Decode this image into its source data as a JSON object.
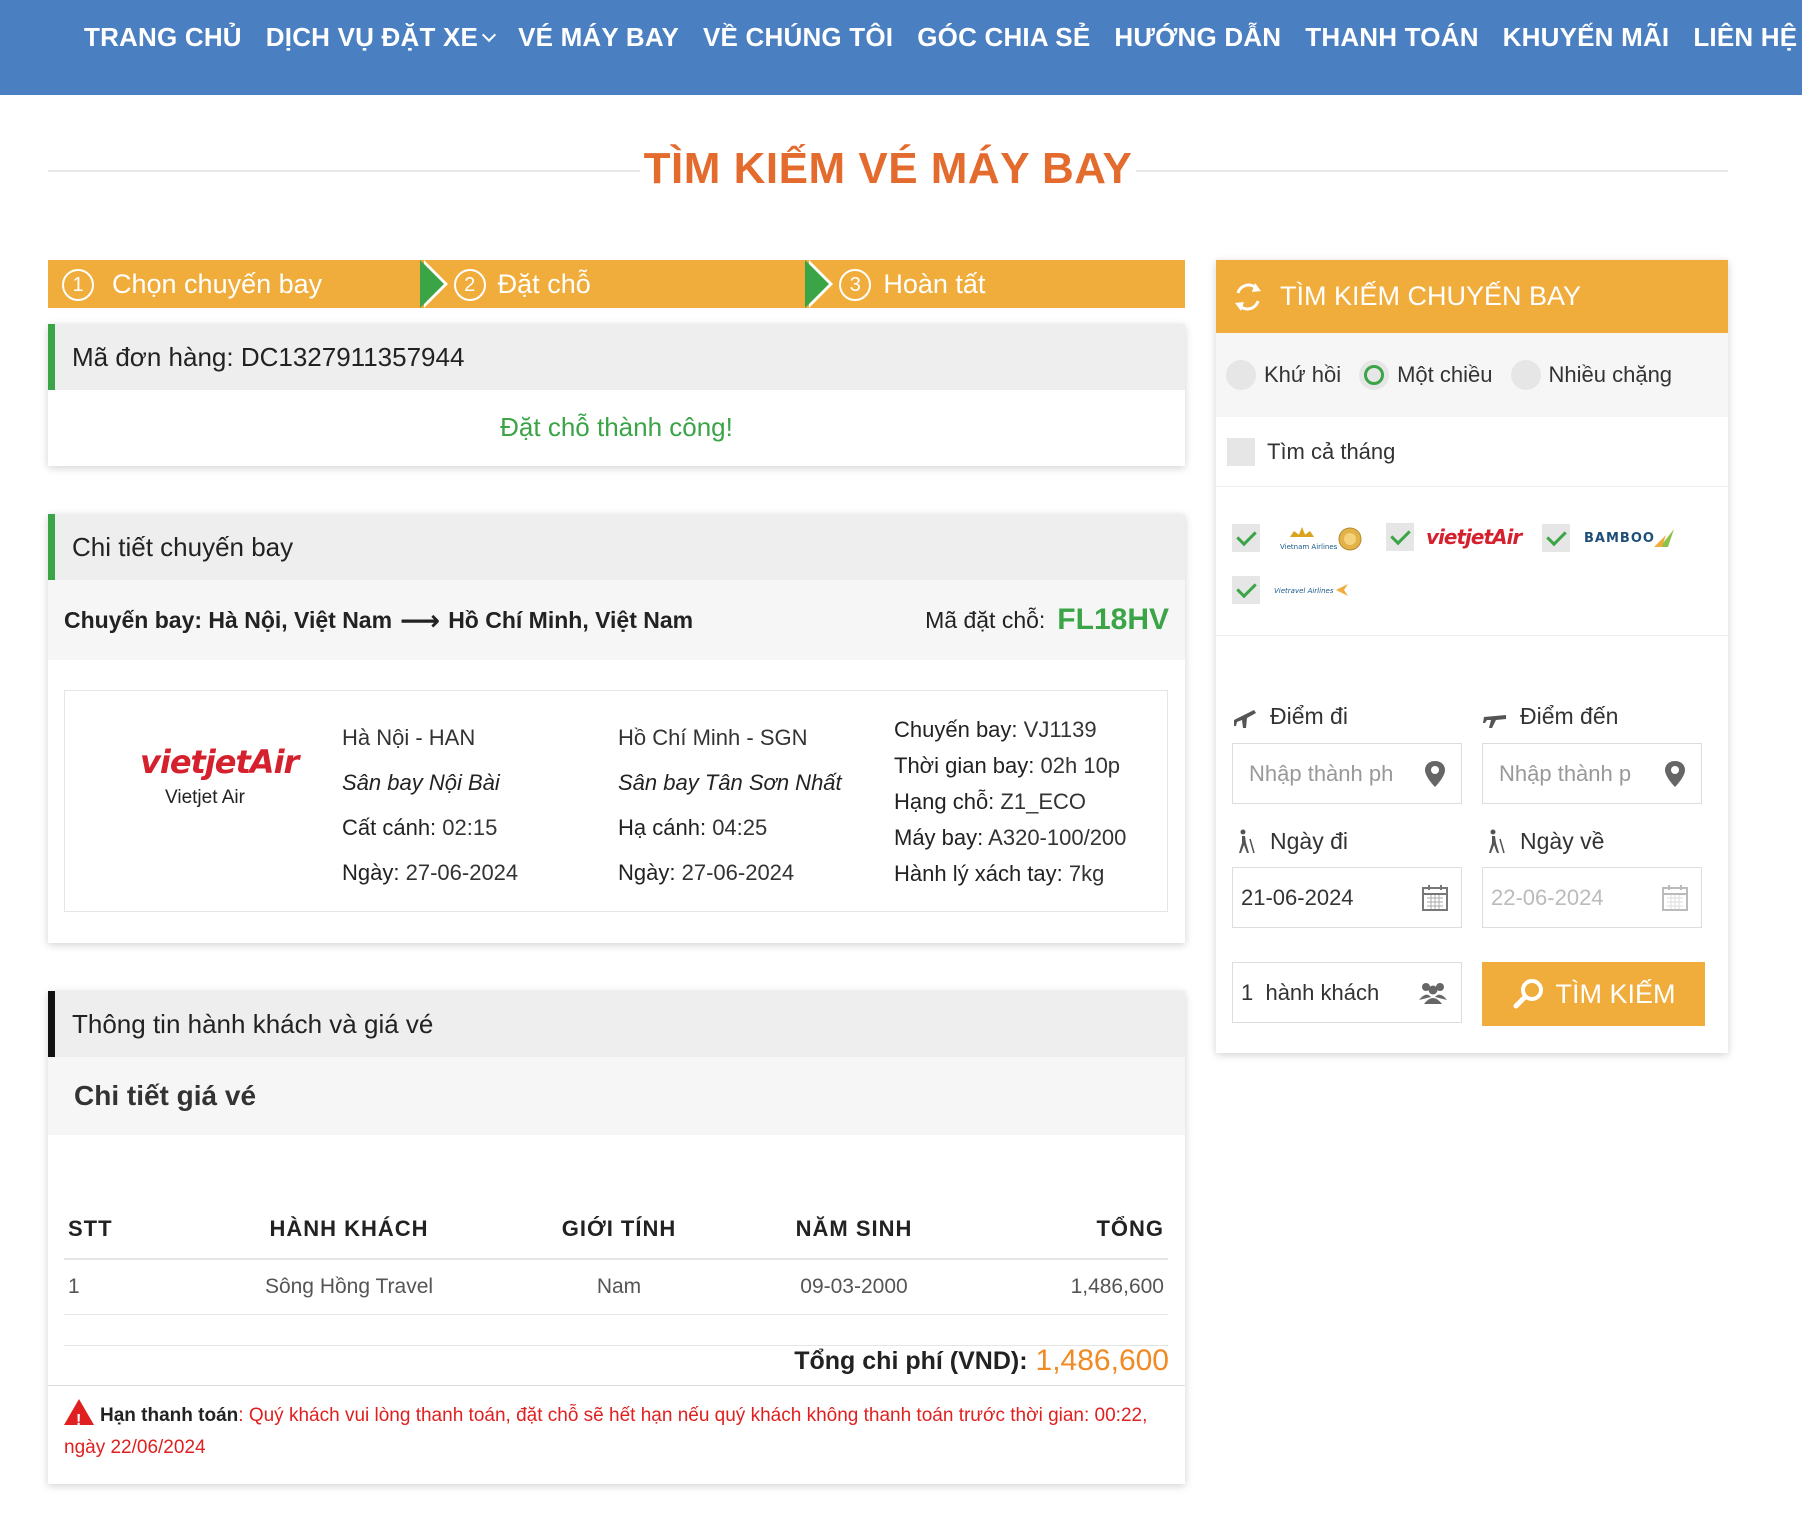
{
  "nav": {
    "items": [
      "TRANG CHỦ",
      "DỊCH VỤ ĐẶT XE",
      "VÉ MÁY BAY",
      "VỀ CHÚNG TÔI",
      "GÓC CHIA SẺ",
      "HƯỚNG DẪN",
      "THANH TOÁN",
      "KHUYẾN MÃI",
      "LIÊN HỆ"
    ]
  },
  "page_title": "TÌM KIẾM VÉ MÁY BAY",
  "steps": [
    {
      "num": "1",
      "label": "Chọn chuyến bay"
    },
    {
      "num": "2",
      "label": "Đặt chỗ"
    },
    {
      "num": "3",
      "label": "Hoàn tất"
    }
  ],
  "order": {
    "label": "Mã đơn hàng: DC1327911357944",
    "message": "Đặt chỗ thành công!"
  },
  "flight": {
    "section_title": "Chi tiết chuyến bay",
    "route_from": "Chuyến bay: Hà Nội, Việt Nam",
    "route_to": "Hồ Chí Minh, Việt Nam",
    "booking_code_label": "Mã đặt chỗ:",
    "booking_code": "FL18HV",
    "airline_logo_text": "vietjetAir",
    "airline_name": "Vietjet Air",
    "departure": {
      "city": "Hà Nội - HAN",
      "airport": "Sân bay Nội Bài",
      "time_label": "Cất cánh:",
      "time": "02:15",
      "date_label": "Ngày:",
      "date": "27-06-2024"
    },
    "arrival": {
      "city": "Hồ Chí Minh - SGN",
      "airport": "Sân bay Tân Sơn Nhất",
      "time_label": "Hạ cánh:",
      "time": "04:25",
      "date_label": "Ngày:",
      "date": "27-06-2024"
    },
    "details": {
      "flight_no_label": "Chuyến bay:",
      "flight_no": "VJ1139",
      "duration_label": "Thời gian bay:",
      "duration": "02h 10p",
      "class_label": "Hạng chỗ:",
      "class": "Z1_ECO",
      "aircraft_label": "Máy bay:",
      "aircraft": "A320-100/200",
      "baggage_label": "Hành lý xách tay:",
      "baggage": "7kg"
    }
  },
  "passengers": {
    "section_title": "Thông tin hành khách và giá vé",
    "price_title": "Chi tiết giá vé",
    "columns": [
      "STT",
      "HÀNH KHÁCH",
      "GIỚI TÍNH",
      "NĂM SINH",
      "TỔNG"
    ],
    "rows": [
      {
        "stt": "1",
        "name": "Sông Hồng Travel",
        "gender": "Nam",
        "dob": "09-03-2000",
        "total": "1,486,600"
      }
    ],
    "total_label": "Tổng chi phí (VND):",
    "total_value": "1,486,600",
    "deadline_label": "Hạn thanh toán",
    "deadline_text": ": Quý khách vui lòng thanh toán, đặt chỗ sẽ hết hạn nếu quý khách không thanh toán trước thời gian: 00:22, ngày 22/06/2024"
  },
  "search": {
    "title": "TÌM KIẾM CHUYẾN BAY",
    "trip_types": [
      "Khứ hồi",
      "Một chiều",
      "Nhiều chặng"
    ],
    "selected_trip": "Một chiều",
    "whole_month_label": "Tìm cả tháng",
    "airlines": [
      "Vietnam Airlines",
      "vietjetAir",
      "BAMBOO",
      "Vietravel Airlines"
    ],
    "from_label": "Điểm đi",
    "to_label": "Điểm đến",
    "from_placeholder": "Nhập thành ph",
    "to_placeholder": "Nhập thành p",
    "depart_label": "Ngày đi",
    "return_label": "Ngày về",
    "depart_date": "21-06-2024",
    "return_date": "22-06-2024",
    "passengers": "1  hành khách",
    "button": "TÌM KIẾM"
  },
  "colors": {
    "nav": "#4a7fc1",
    "accent": "#f0ad3c",
    "title": "#e46b2e",
    "success": "#3aa447",
    "danger": "#e02020"
  }
}
